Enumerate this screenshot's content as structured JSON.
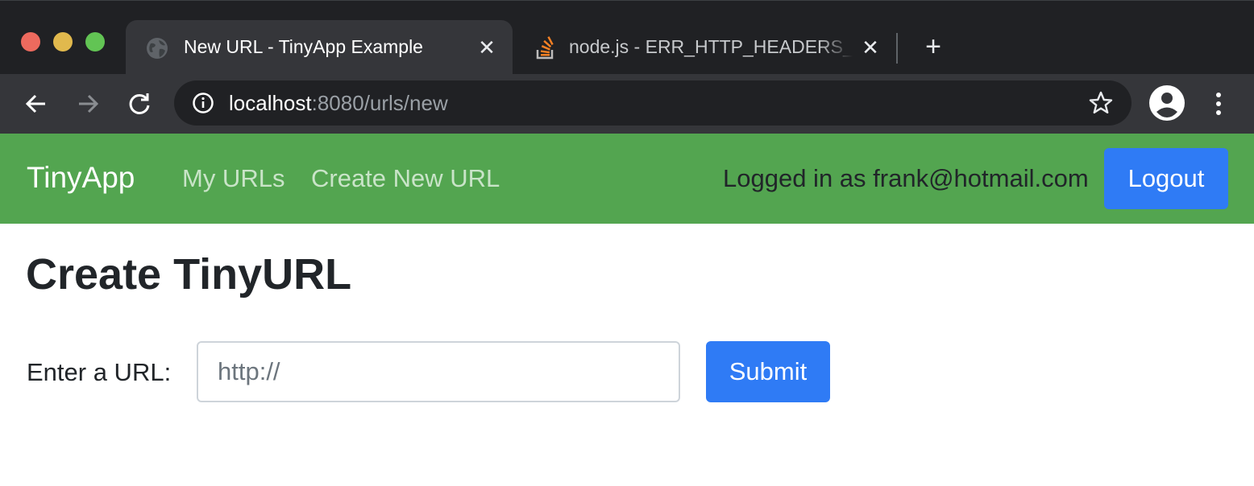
{
  "browser": {
    "tabs": [
      {
        "title": "New URL - TinyApp Example",
        "icon": "globe-icon",
        "active": true
      },
      {
        "title": "node.js - ERR_HTTP_HEADERS_SENT",
        "icon": "stackoverflow-icon",
        "active": false
      }
    ],
    "close_glyph": "✕",
    "new_tab_glyph": "+",
    "address": {
      "host": "localhost",
      "rest": ":8080/urls/new"
    }
  },
  "navbar": {
    "brand": "TinyApp",
    "links": [
      "My URLs",
      "Create New URL"
    ],
    "logged_in_text": "Logged in as frank@hotmail.com",
    "logout_label": "Logout"
  },
  "main": {
    "title": "Create TinyURL",
    "form": {
      "label": "Enter a URL:",
      "input_value": "",
      "placeholder": "http://",
      "submit_label": "Submit"
    }
  },
  "colors": {
    "navbar_bg": "#53a550",
    "primary_button": "#2f7bf5",
    "tabstrip_bg": "#202124",
    "toolbar_bg": "#35363a"
  }
}
